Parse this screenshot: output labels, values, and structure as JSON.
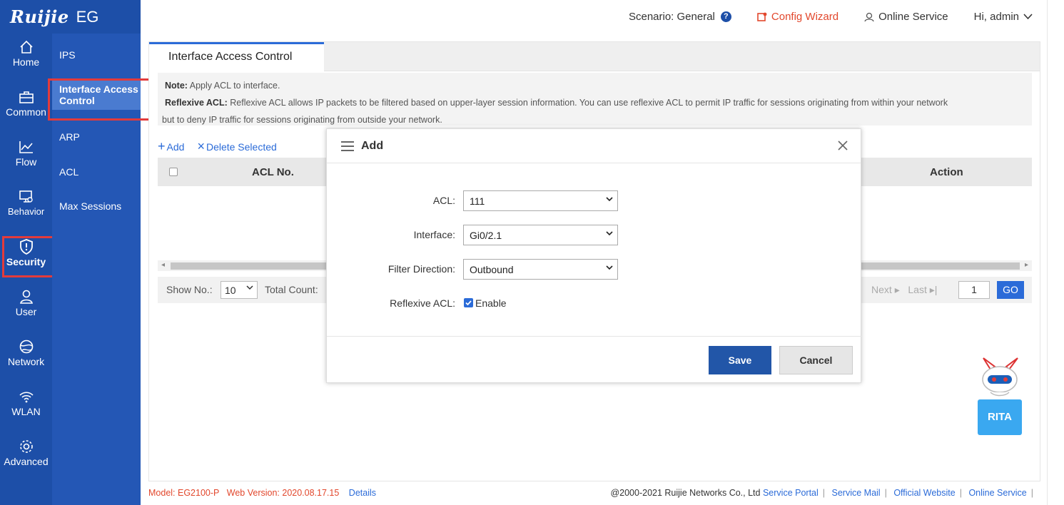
{
  "brand": {
    "name": "Ruijie",
    "product": "EG"
  },
  "topbar": {
    "scenario_label": "Scenario:",
    "scenario_value": "General",
    "help": "?",
    "config_wizard": "Config Wizard",
    "online_service": "Online Service",
    "user": "Hi, admin"
  },
  "rail": {
    "items": [
      {
        "label": "Home",
        "icon": "home-icon"
      },
      {
        "label": "Common",
        "icon": "briefcase-icon"
      },
      {
        "label": "Flow",
        "icon": "chart-line-icon"
      },
      {
        "label": "Behavior",
        "icon": "monitor-icon"
      },
      {
        "label": "Security",
        "icon": "shield-icon",
        "active": true
      },
      {
        "label": "User",
        "icon": "user-icon"
      },
      {
        "label": "Network",
        "icon": "globe-icon"
      },
      {
        "label": "WLAN",
        "icon": "wifi-icon"
      },
      {
        "label": "Advanced",
        "icon": "gear-icon"
      }
    ]
  },
  "subnav": {
    "items": [
      {
        "label": "IPS"
      },
      {
        "label": "Interface Access Control",
        "active": true
      },
      {
        "label": "ARP"
      },
      {
        "label": "ACL"
      },
      {
        "label": "Max Sessions"
      }
    ]
  },
  "page": {
    "tab": "Interface Access Control",
    "note_label": "Note:",
    "note_text": "Apply ACL to interface.",
    "reflexive_label": "Reflexive ACL:",
    "reflexive_text": "Reflexive ACL allows IP packets to be filtered based on upper-layer session information. You can use reflexive ACL to permit IP traffic for sessions originating from within your network",
    "reflexive_text2": "but to deny IP traffic for sessions originating from outside your network.",
    "add": "Add",
    "delete_selected": "Delete Selected",
    "col_acl": "ACL No.",
    "col_action": "Action",
    "show_no": "Show No.:",
    "page_size": "10",
    "total_count": "Total Count:",
    "next": "Next",
    "last": "Last",
    "page_input": "1",
    "go": "GO"
  },
  "modal": {
    "title": "Add",
    "fields": {
      "acl_label": "ACL:",
      "acl_value": "111",
      "interface_label": "Interface:",
      "interface_value": "Gi0/2.1",
      "direction_label": "Filter Direction:",
      "direction_value": "Outbound",
      "reflexive_label": "Reflexive ACL:",
      "reflexive_option": "Enable"
    },
    "save": "Save",
    "cancel": "Cancel"
  },
  "footer": {
    "model": "Model:  EG2100-P",
    "web_version": "Web Version:  2020.08.17.15",
    "details": "Details",
    "copyright": "@2000-2021 Ruijie Networks Co., Ltd",
    "links": [
      "Service Portal",
      "Service Mail",
      "Official Website",
      "Online Service"
    ]
  },
  "rita": {
    "label": "RITA"
  },
  "colors": {
    "primary": "#1d4fa8",
    "accent": "#2b6bd8",
    "highlight": "#e33b3b",
    "wizard": "#e2472c"
  }
}
